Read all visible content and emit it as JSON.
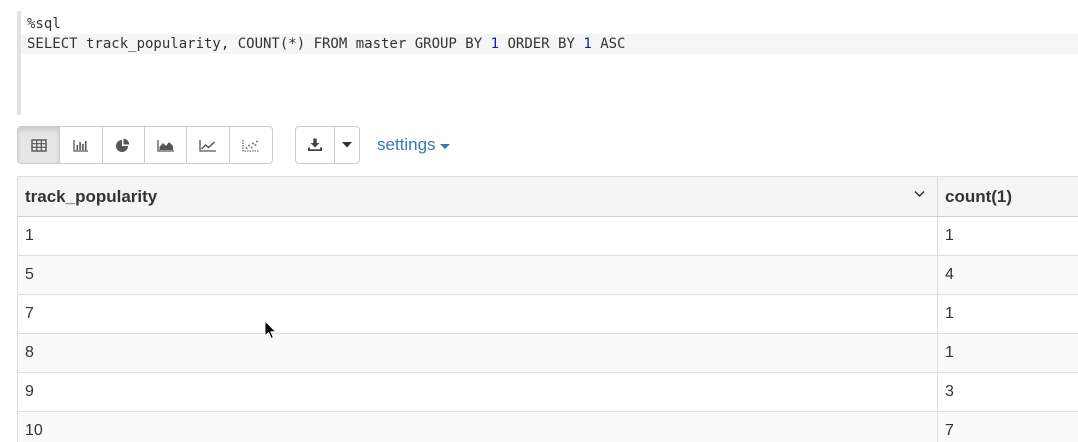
{
  "editor": {
    "line1": "%sql",
    "line2": {
      "seg1": "SELECT track_popularity, COUNT(*) FROM master GROUP BY ",
      "num1": "1",
      "seg2": " ORDER BY ",
      "num2": "1",
      "seg3": " ASC"
    }
  },
  "toolbar": {
    "viz_buttons": [
      {
        "icon": "table-icon",
        "active": true
      },
      {
        "icon": "bar-chart-icon",
        "active": false
      },
      {
        "icon": "pie-chart-icon",
        "active": false
      },
      {
        "icon": "area-chart-icon",
        "active": false
      },
      {
        "icon": "line-chart-icon",
        "active": false
      },
      {
        "icon": "scatter-chart-icon",
        "active": false
      }
    ],
    "download_icon": "download-icon",
    "dropdown_icon": "caret-down-icon",
    "settings_label": "settings"
  },
  "table": {
    "columns": [
      "track_popularity",
      "count(1)"
    ],
    "rows": [
      [
        "1",
        "1"
      ],
      [
        "5",
        "4"
      ],
      [
        "7",
        "1"
      ],
      [
        "8",
        "1"
      ],
      [
        "9",
        "3"
      ],
      [
        "10",
        "7"
      ]
    ]
  },
  "colors": {
    "link": "#337ab7",
    "number_literal": "#1a1aa6",
    "border": "#dddddd",
    "header_bg": "#f5f5f5"
  }
}
